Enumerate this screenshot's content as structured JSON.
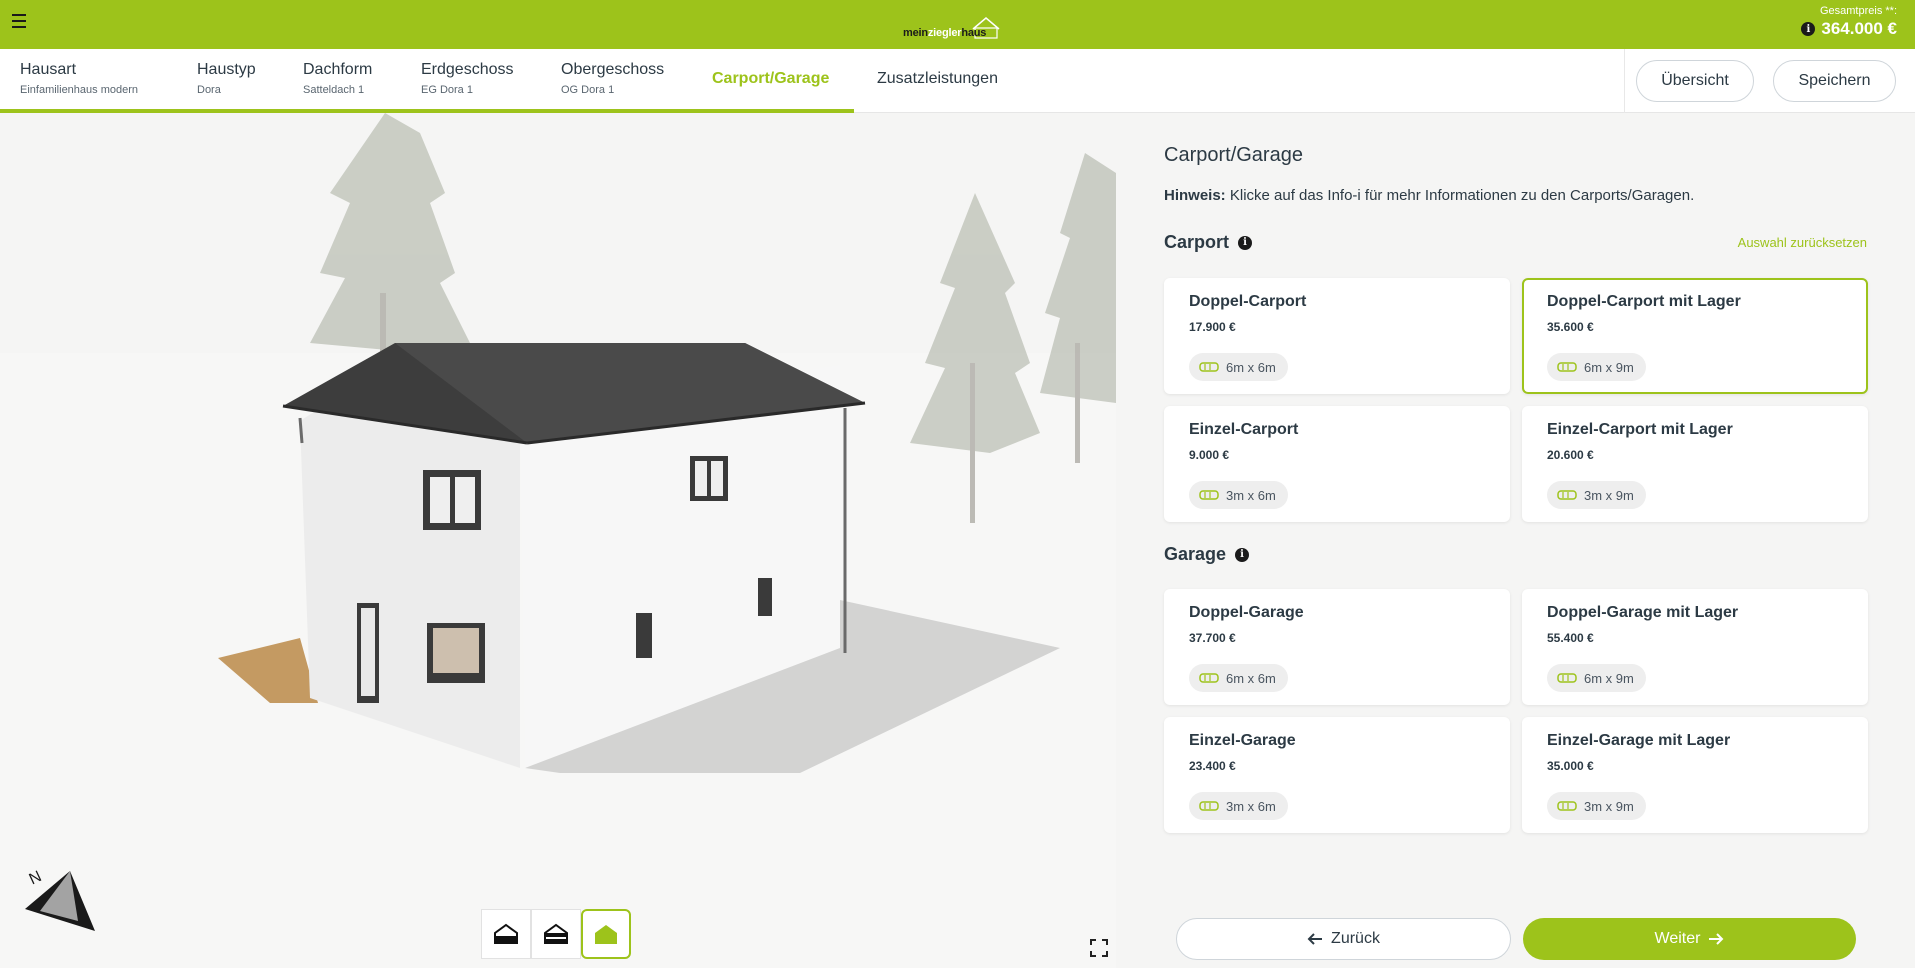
{
  "topbar": {
    "logo": {
      "part1": "mein",
      "part2": "ziegler",
      "part3": "haus"
    },
    "price_label": "Gesamtpreis **:",
    "price_value": "364.000 €"
  },
  "steps": [
    {
      "title": "Hausart",
      "sub": "Einfamilienhaus modern"
    },
    {
      "title": "Haustyp",
      "sub": "Dora"
    },
    {
      "title": "Dachform",
      "sub": "Satteldach 1"
    },
    {
      "title": "Erdgeschoss",
      "sub": "EG Dora 1"
    },
    {
      "title": "Obergeschoss",
      "sub": "OG Dora 1"
    },
    {
      "title": "Carport/Garage",
      "sub": ""
    },
    {
      "title": "Zusatzleistungen",
      "sub": ""
    }
  ],
  "nav_buttons": {
    "overview": "Übersicht",
    "save": "Speichern"
  },
  "panel": {
    "title": "Carport/Garage",
    "hint_label": "Hinweis:",
    "hint_text": " Klicke auf das Info-i für mehr Informationen zu den Carports/Garagen.",
    "reset": "Auswahl zurücksetzen",
    "carport_title": "Carport",
    "garage_title": "Garage",
    "carports": [
      {
        "name": "Doppel-Carport",
        "price": "17.900 €",
        "size": "6m x 6m",
        "selected": false
      },
      {
        "name": "Doppel-Carport mit Lager",
        "price": "35.600 €",
        "size": "6m x 9m",
        "selected": true
      },
      {
        "name": "Einzel-Carport",
        "price": "9.000 €",
        "size": "3m x 6m",
        "selected": false
      },
      {
        "name": "Einzel-Carport mit Lager",
        "price": "20.600 €",
        "size": "3m x 9m",
        "selected": false
      }
    ],
    "garages": [
      {
        "name": "Doppel-Garage",
        "price": "37.700 €",
        "size": "6m x 6m",
        "selected": false
      },
      {
        "name": "Doppel-Garage mit Lager",
        "price": "55.400 €",
        "size": "6m x 9m",
        "selected": false
      },
      {
        "name": "Einzel-Garage",
        "price": "23.400 €",
        "size": "3m x 6m",
        "selected": false
      },
      {
        "name": "Einzel-Garage mit Lager",
        "price": "35.000 €",
        "size": "3m x 9m",
        "selected": false
      }
    ]
  },
  "footer": {
    "back": "Zurück",
    "next": "Weiter"
  },
  "colors": {
    "accent": "#9dc31b",
    "text": "#2c3a44",
    "panel_bg": "#f5f5f4"
  },
  "icons": [
    "menu-icon",
    "info-icon",
    "size-icon",
    "arrow-left-icon",
    "arrow-right-icon",
    "fullscreen-icon",
    "compass-icon",
    "view-roof-icon",
    "view-cut-icon",
    "view-house-icon"
  ]
}
